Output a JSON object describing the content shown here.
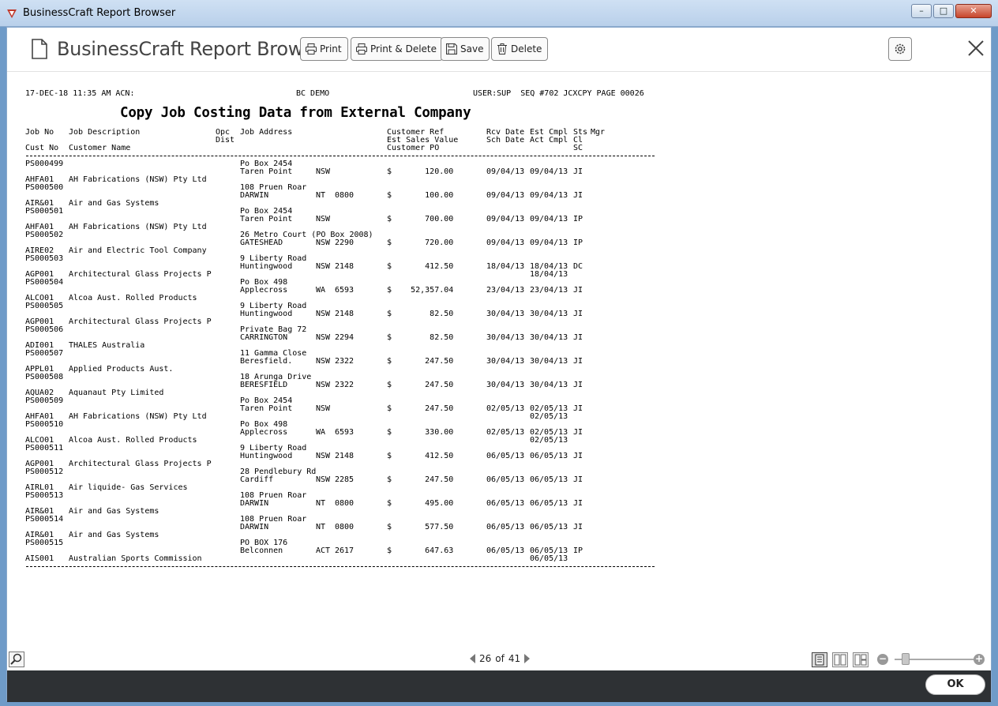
{
  "window": {
    "title": "BusinessCraft Report Browser",
    "minimize": "–",
    "maximize": "□",
    "close": "✕"
  },
  "toolbar": {
    "title": "BusinessCraft Report Browser",
    "print_label": "Print",
    "print_delete_label": "Print & Delete",
    "save_label": "Save",
    "delete_label": "Delete"
  },
  "report": {
    "header_left": "17-DEC-18 11:35 AM ACN:",
    "header_mid": "BC DEMO",
    "header_right": "USER:SUP  SEQ #702 JCXCPY PAGE 00026",
    "title": "Copy Job Costing Data from External Company",
    "col_job_no": "Job No",
    "col_job_desc": "Job Description",
    "col_opc": "Opc",
    "col_dist": "Dist",
    "col_job_address": "Job Address",
    "col_cust_ref": "Customer Ref",
    "col_est_sales": "Est Sales Value",
    "col_cust_po": "Customer PO",
    "col_rcv_date": "Rcv Date",
    "col_est_cmpl": "Est Cmpl",
    "col_sts": "Sts",
    "col_mgr": "Mgr",
    "col_sch_date": "Sch Date",
    "col_act_cmpl": "Act Cmpl",
    "col_cl": "Cl",
    "col_cust_no": "Cust No",
    "col_cust_name": "Customer Name",
    "col_sc": "SC",
    "rows": [
      {
        "job": "PS000499",
        "addr1": "Po Box 2454",
        "addr2": "Taren Point",
        "state": "NSW",
        "pc": "",
        "amt": "$       120.00",
        "rcv": "09/04/13",
        "cmpl": "09/04/13",
        "sts": "JI",
        "act": "",
        "cust": "AHFA01",
        "name": "AH Fabrications (NSW) Pty Ltd"
      },
      {
        "job": "PS000500",
        "addr1": "108 Pruen Roar",
        "addr2": "DARWIN",
        "state": "NT",
        "pc": "0800",
        "amt": "$       100.00",
        "rcv": "09/04/13",
        "cmpl": "09/04/13",
        "sts": "JI",
        "act": "",
        "cust": "AIR&01",
        "name": "Air and Gas Systems"
      },
      {
        "job": "PS000501",
        "addr1": "Po Box 2454",
        "addr2": "Taren Point",
        "state": "NSW",
        "pc": "",
        "amt": "$       700.00",
        "rcv": "09/04/13",
        "cmpl": "09/04/13",
        "sts": "IP",
        "act": "",
        "cust": "AHFA01",
        "name": "AH Fabrications (NSW) Pty Ltd"
      },
      {
        "job": "PS000502",
        "addr1": "26 Metro Court (PO Box 2008)",
        "addr2": "GATESHEAD",
        "state": "NSW",
        "pc": "2290",
        "amt": "$       720.00",
        "rcv": "09/04/13",
        "cmpl": "09/04/13",
        "sts": "IP",
        "act": "",
        "cust": "AIRE02",
        "name": "Air and Electric Tool Company"
      },
      {
        "job": "PS000503",
        "addr1": "9 Liberty Road",
        "addr2": "Huntingwood",
        "state": "NSW",
        "pc": "2148",
        "amt": "$       412.50",
        "rcv": "18/04/13",
        "cmpl": "18/04/13",
        "sts": "DC",
        "act": "18/04/13",
        "cust": "AGP001",
        "name": "Architectural Glass Projects P"
      },
      {
        "job": "PS000504",
        "addr1": "Po Box 498",
        "addr2": "Applecross",
        "state": "WA",
        "pc": "6593",
        "amt": "$    52,357.04",
        "rcv": "23/04/13",
        "cmpl": "23/04/13",
        "sts": "JI",
        "act": "",
        "cust": "ALCO01",
        "name": "Alcoa Aust. Rolled Products"
      },
      {
        "job": "PS000505",
        "addr1": "9 Liberty Road",
        "addr2": "Huntingwood",
        "state": "NSW",
        "pc": "2148",
        "amt": "$        82.50",
        "rcv": "30/04/13",
        "cmpl": "30/04/13",
        "sts": "JI",
        "act": "",
        "cust": "AGP001",
        "name": "Architectural Glass Projects P"
      },
      {
        "job": "PS000506",
        "addr1": "Private Bag 72",
        "addr2": "CARRINGTON",
        "state": "NSW",
        "pc": "2294",
        "amt": "$        82.50",
        "rcv": "30/04/13",
        "cmpl": "30/04/13",
        "sts": "JI",
        "act": "",
        "cust": "ADI001",
        "name": "THALES Australia"
      },
      {
        "job": "PS000507",
        "addr1": "11 Gamma Close",
        "addr2": "Beresfield.",
        "state": "NSW",
        "pc": "2322",
        "amt": "$       247.50",
        "rcv": "30/04/13",
        "cmpl": "30/04/13",
        "sts": "JI",
        "act": "",
        "cust": "APPL01",
        "name": "Applied Products Aust."
      },
      {
        "job": "PS000508",
        "addr1": "18 Arunga Drive",
        "addr2": "BERESFIELD",
        "state": "NSW",
        "pc": "2322",
        "amt": "$       247.50",
        "rcv": "30/04/13",
        "cmpl": "30/04/13",
        "sts": "JI",
        "act": "",
        "cust": "AQUA02",
        "name": "Aquanaut Pty Limited"
      },
      {
        "job": "PS000509",
        "addr1": "Po Box 2454",
        "addr2": "Taren Point",
        "state": "NSW",
        "pc": "",
        "amt": "$       247.50",
        "rcv": "02/05/13",
        "cmpl": "02/05/13",
        "sts": "JI",
        "act": "02/05/13",
        "cust": "AHFA01",
        "name": "AH Fabrications (NSW) Pty Ltd"
      },
      {
        "job": "PS000510",
        "addr1": "Po Box 498",
        "addr2": "Applecross",
        "state": "WA",
        "pc": "6593",
        "amt": "$       330.00",
        "rcv": "02/05/13",
        "cmpl": "02/05/13",
        "sts": "JI",
        "act": "02/05/13",
        "cust": "ALCO01",
        "name": "Alcoa Aust. Rolled Products"
      },
      {
        "job": "PS000511",
        "addr1": "9 Liberty Road",
        "addr2": "Huntingwood",
        "state": "NSW",
        "pc": "2148",
        "amt": "$       412.50",
        "rcv": "06/05/13",
        "cmpl": "06/05/13",
        "sts": "JI",
        "act": "",
        "cust": "AGP001",
        "name": "Architectural Glass Projects P"
      },
      {
        "job": "PS000512",
        "addr1": "28 Pendlebury Rd",
        "addr2": "Cardiff",
        "state": "NSW",
        "pc": "2285",
        "amt": "$       247.50",
        "rcv": "06/05/13",
        "cmpl": "06/05/13",
        "sts": "JI",
        "act": "",
        "cust": "AIRL01",
        "name": "Air liquide- Gas Services"
      },
      {
        "job": "PS000513",
        "addr1": "108 Pruen Roar",
        "addr2": "DARWIN",
        "state": "NT",
        "pc": "0800",
        "amt": "$       495.00",
        "rcv": "06/05/13",
        "cmpl": "06/05/13",
        "sts": "JI",
        "act": "",
        "cust": "AIR&01",
        "name": "Air and Gas Systems"
      },
      {
        "job": "PS000514",
        "addr1": "108 Pruen Roar",
        "addr2": "DARWIN",
        "state": "NT",
        "pc": "0800",
        "amt": "$       577.50",
        "rcv": "06/05/13",
        "cmpl": "06/05/13",
        "sts": "JI",
        "act": "",
        "cust": "AIR&01",
        "name": "Air and Gas Systems"
      },
      {
        "job": "PS000515",
        "addr1": "PO BOX 176",
        "addr2": "Belconnen",
        "state": "ACT",
        "pc": "2617",
        "amt": "$       647.63",
        "rcv": "06/05/13",
        "cmpl": "06/05/13",
        "sts": "IP",
        "act": "06/05/13",
        "cust": "AIS001",
        "name": "Australian Sports Commission"
      }
    ]
  },
  "pager": {
    "current": "26",
    "of_label": "of",
    "total": "41"
  },
  "footer": {
    "ok_label": "OK"
  }
}
